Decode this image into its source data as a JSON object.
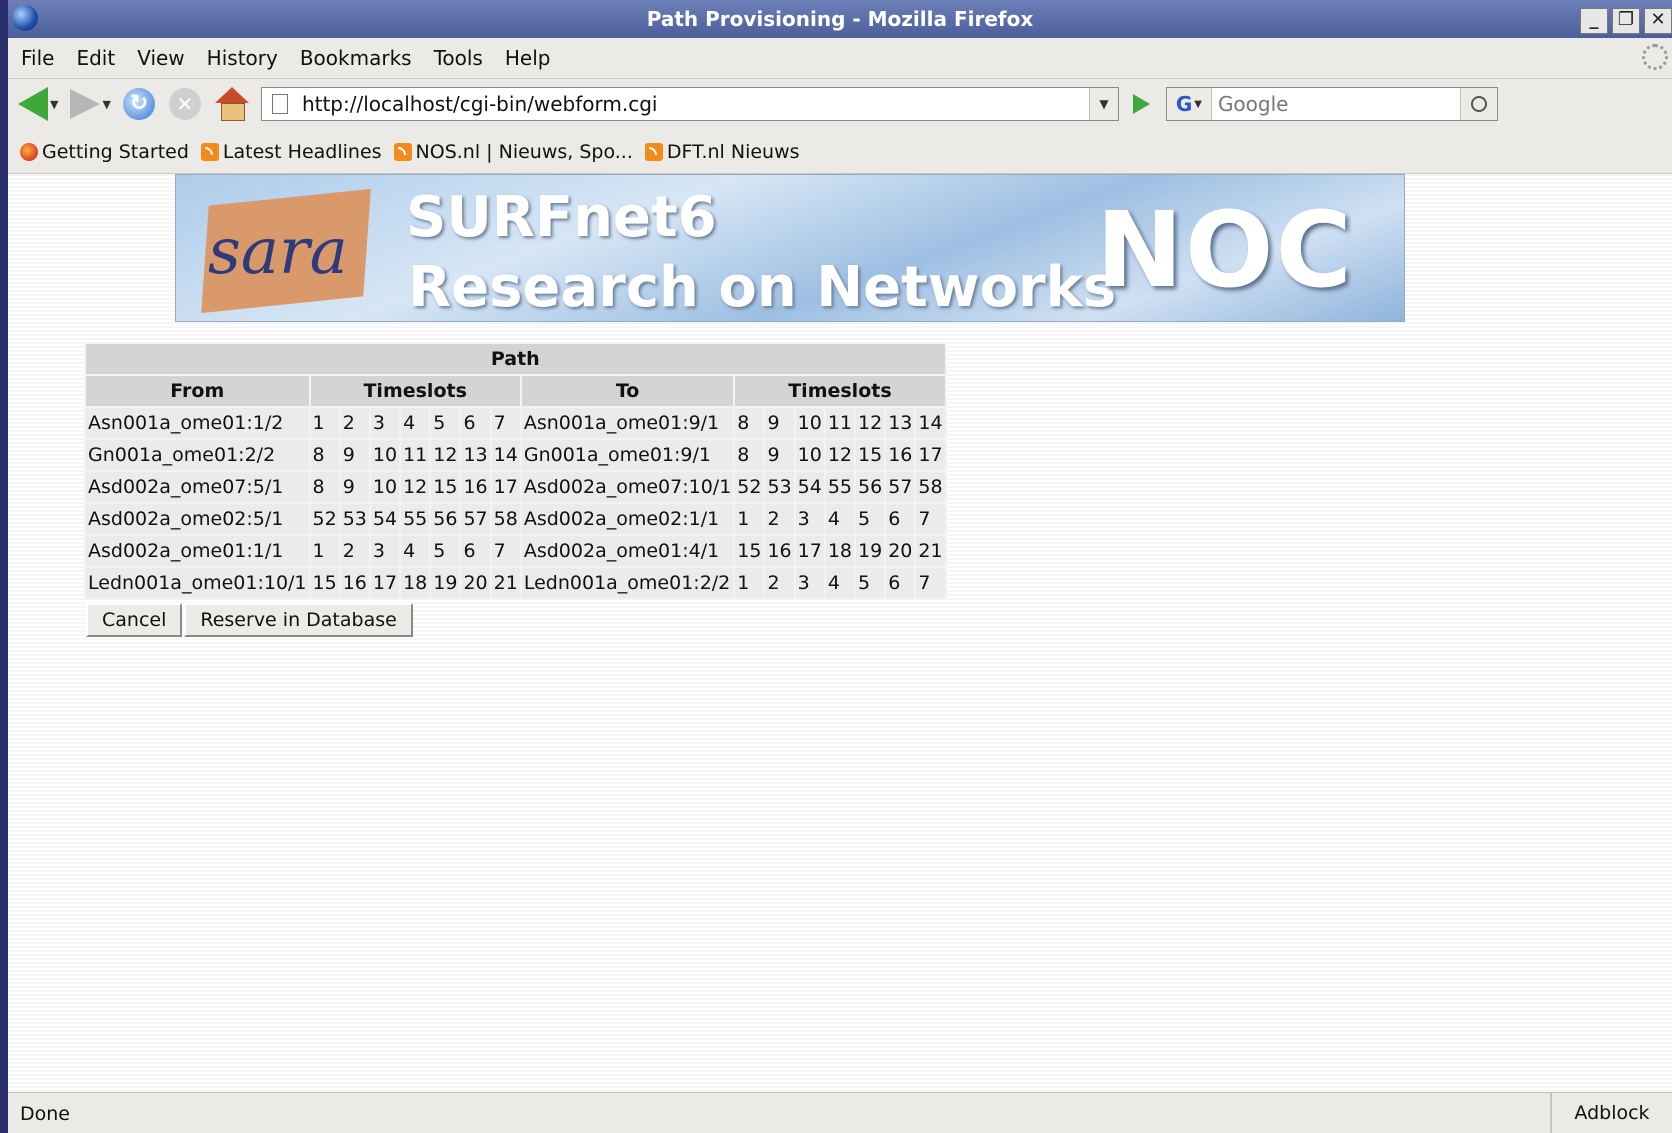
{
  "window": {
    "title": "Path Provisioning - Mozilla Firefox"
  },
  "menu": [
    "File",
    "Edit",
    "View",
    "History",
    "Bookmarks",
    "Tools",
    "Help"
  ],
  "navigation": {
    "url": "http://localhost/cgi-bin/webform.cgi",
    "search_placeholder": "Google"
  },
  "bookmarks": [
    "Getting Started",
    "Latest Headlines",
    "NOS.nl | Nieuws, Spo...",
    "DFT.nl Nieuws"
  ],
  "banner": {
    "logo": "sara",
    "line1": "SURFnet6",
    "line2": "Research on Networks",
    "noc": "NOC"
  },
  "table": {
    "caption": "Path",
    "headers": {
      "from": "From",
      "timeslots": "Timeslots",
      "to": "To"
    },
    "rows": [
      {
        "from": "Asn001a_ome01:1/2",
        "from_slots": [
          "1",
          "2",
          "3",
          "4",
          "5",
          "6",
          "7"
        ],
        "to": "Asn001a_ome01:9/1",
        "to_slots": [
          "8",
          "9",
          "10",
          "11",
          "12",
          "13",
          "14"
        ]
      },
      {
        "from": "Gn001a_ome01:2/2",
        "from_slots": [
          "8",
          "9",
          "10",
          "11",
          "12",
          "13",
          "14"
        ],
        "to": "Gn001a_ome01:9/1",
        "to_slots": [
          "8",
          "9",
          "10",
          "12",
          "15",
          "16",
          "17"
        ]
      },
      {
        "from": "Asd002a_ome07:5/1",
        "from_slots": [
          "8",
          "9",
          "10",
          "12",
          "15",
          "16",
          "17"
        ],
        "to": "Asd002a_ome07:10/1",
        "to_slots": [
          "52",
          "53",
          "54",
          "55",
          "56",
          "57",
          "58"
        ]
      },
      {
        "from": "Asd002a_ome02:5/1",
        "from_slots": [
          "52",
          "53",
          "54",
          "55",
          "56",
          "57",
          "58"
        ],
        "to": "Asd002a_ome02:1/1",
        "to_slots": [
          "1",
          "2",
          "3",
          "4",
          "5",
          "6",
          "7"
        ]
      },
      {
        "from": "Asd002a_ome01:1/1",
        "from_slots": [
          "1",
          "2",
          "3",
          "4",
          "5",
          "6",
          "7"
        ],
        "to": "Asd002a_ome01:4/1",
        "to_slots": [
          "15",
          "16",
          "17",
          "18",
          "19",
          "20",
          "21"
        ]
      },
      {
        "from": "Ledn001a_ome01:10/1",
        "from_slots": [
          "15",
          "16",
          "17",
          "18",
          "19",
          "20",
          "21"
        ],
        "to": "Ledn001a_ome01:2/2",
        "to_slots": [
          "1",
          "2",
          "3",
          "4",
          "5",
          "6",
          "7"
        ]
      }
    ]
  },
  "buttons": {
    "cancel": "Cancel",
    "reserve": "Reserve in Database"
  },
  "status": {
    "text": "Done",
    "addon": "Adblock"
  }
}
